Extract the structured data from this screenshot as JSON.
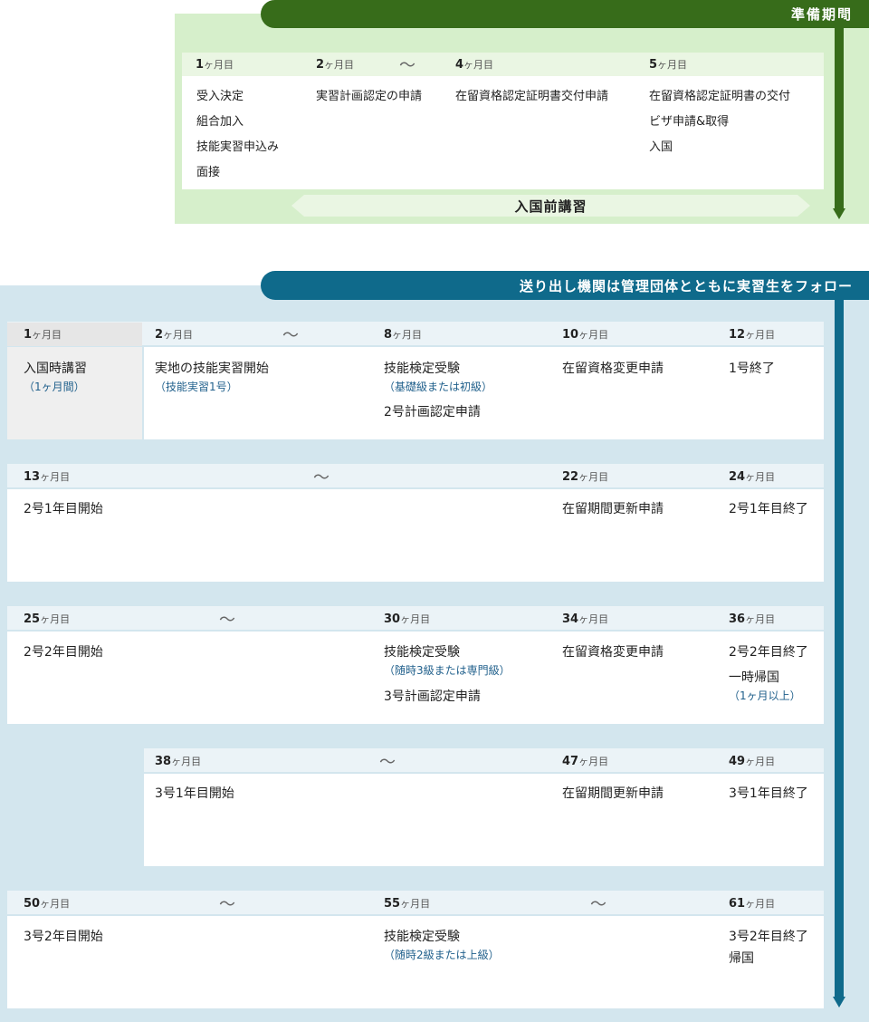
{
  "prep": {
    "banner": "準備期間",
    "headers": [
      {
        "num": "1",
        "unit": "ヶ月目"
      },
      {
        "num": "2",
        "unit": "ヶ月目"
      },
      {
        "num": "4",
        "unit": "ヶ月目"
      },
      {
        "num": "5",
        "unit": "ヶ月目"
      }
    ],
    "tilde": "〜",
    "col1": [
      "受入決定",
      "組合加入",
      "技能実習申込み",
      "面接"
    ],
    "col2": [
      "実習計画認定の申請"
    ],
    "col3": [
      "在留資格認定証明書交付申請"
    ],
    "col4": [
      "在留資格認定証明書の交付",
      "ビザ申請&取得",
      "入国"
    ],
    "training": "入国前講習"
  },
  "send": {
    "banner": "送り出し機関は管理団体とともに実習生をフォロー",
    "unit": "ヶ月目",
    "tilde": "〜",
    "rows": [
      {
        "h": [
          "1",
          "2",
          "8",
          "10",
          "12"
        ],
        "e1": "入国時講習",
        "n1": "（1ヶ月間）",
        "e2": "実地の技能実習開始",
        "n2": "（技能実習1号）",
        "e3": "技能検定受験",
        "n3": "（基礎級または初級）",
        "e3b": "2号計画認定申請",
        "e4": "在留資格変更申請",
        "e5": "1号終了"
      },
      {
        "h": [
          "13",
          "22",
          "24"
        ],
        "e1": "2号1年目開始",
        "e4": "在留期間更新申請",
        "e5": "2号1年目終了"
      },
      {
        "h": [
          "25",
          "30",
          "34",
          "36"
        ],
        "e1": "2号2年目開始",
        "e3": "技能検定受験",
        "n3": "（随時3級または専門級）",
        "e3b": "3号計画認定申請",
        "e4": "在留資格変更申請",
        "e5": "2号2年目終了",
        "e5b": "一時帰国",
        "n5": "（1ヶ月以上）"
      },
      {
        "h": [
          "38",
          "47",
          "49"
        ],
        "e2": "3号1年目開始",
        "e4": "在留期間更新申請",
        "e5": "3号1年目終了"
      },
      {
        "h": [
          "50",
          "55",
          "61"
        ],
        "e1": "3号2年目開始",
        "e3": "技能検定受験",
        "n3": "（随時2級または上級）",
        "e5": "3号2年目終了",
        "e5b": "帰国"
      }
    ]
  },
  "colors": {
    "prep": "#376c1a",
    "prep_bg": "#d6efcb",
    "send": "#0f6a8b",
    "send_bg": "#d3e6ee",
    "note": "#1f5f8b"
  }
}
